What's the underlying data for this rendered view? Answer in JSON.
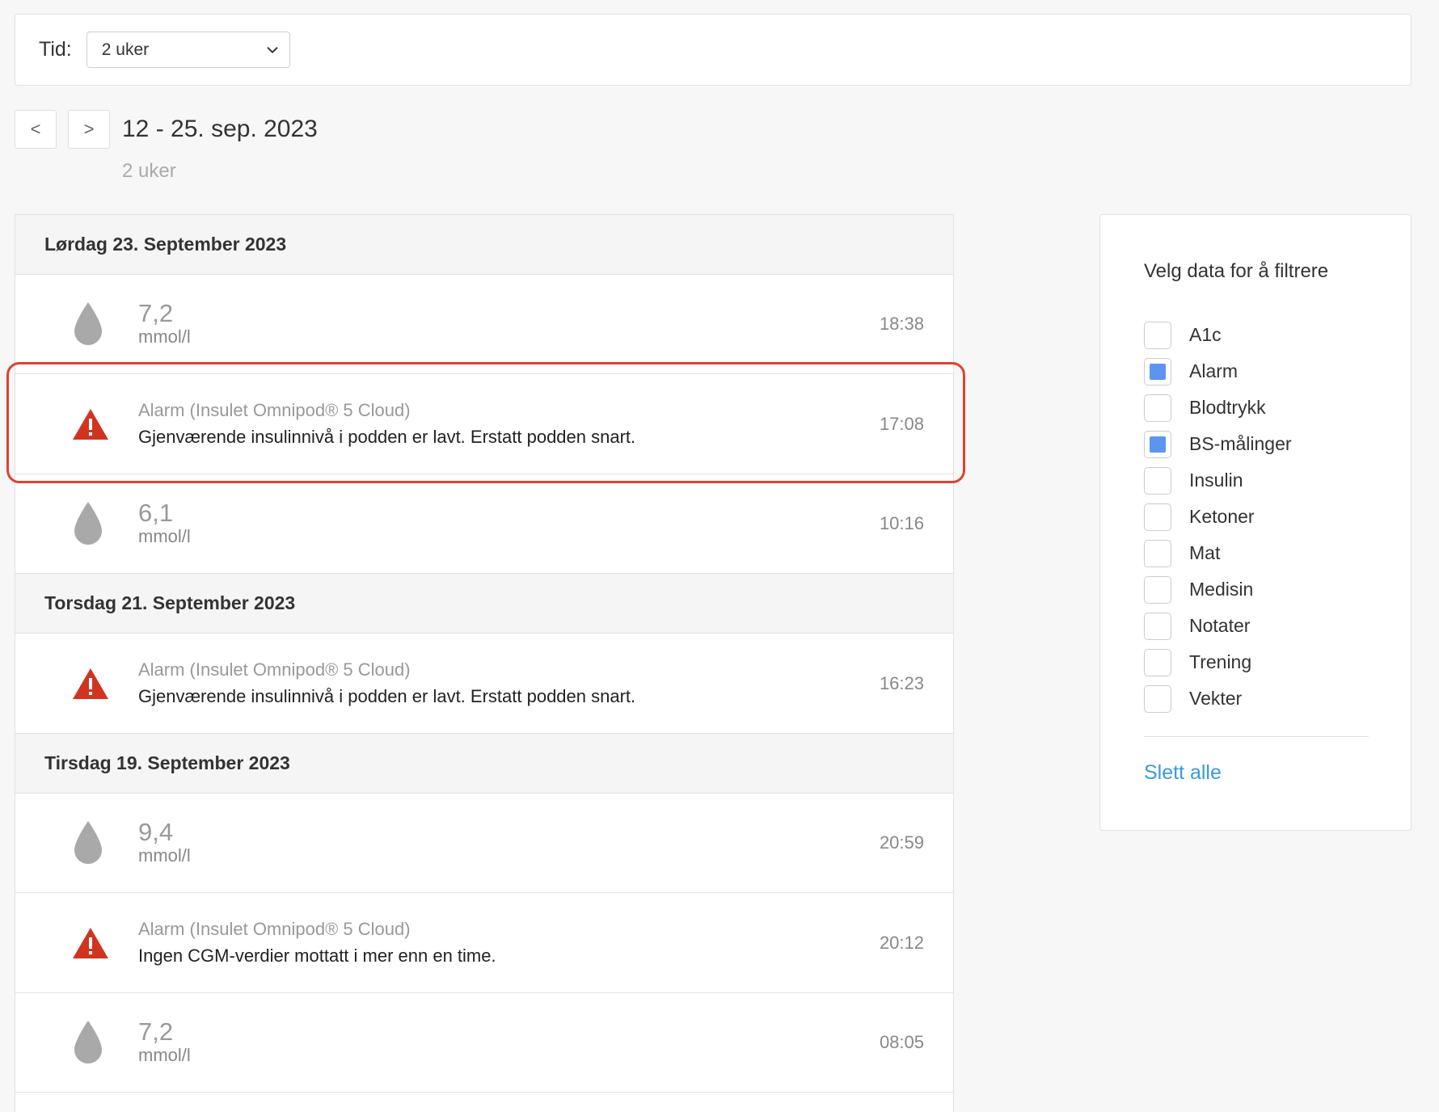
{
  "top_bar": {
    "time_label": "Tid:",
    "time_select_value": "2 uker"
  },
  "navigation": {
    "prev_label": "<",
    "next_label": ">",
    "range_title": "12 - 25. sep. 2023",
    "range_subtitle": "2 uker"
  },
  "days": [
    {
      "header": "Lørdag 23. September 2023",
      "entries": [
        {
          "type": "bs",
          "value": "7,2",
          "unit": "mmol/l",
          "time": "18:38"
        },
        {
          "type": "alarm",
          "source": "Alarm (Insulet Omnipod® 5 Cloud)",
          "message": "Gjenværende insulinnivå i podden er lavt. Erstatt podden snart.",
          "time": "17:08",
          "highlighted": true
        },
        {
          "type": "bs",
          "value": "6,1",
          "unit": "mmol/l",
          "time": "10:16"
        }
      ]
    },
    {
      "header": "Torsdag 21. September 2023",
      "entries": [
        {
          "type": "alarm",
          "source": "Alarm (Insulet Omnipod® 5 Cloud)",
          "message": "Gjenværende insulinnivå i podden er lavt. Erstatt podden snart.",
          "time": "16:23"
        }
      ]
    },
    {
      "header": "Tirsdag 19. September 2023",
      "entries": [
        {
          "type": "bs",
          "value": "9,4",
          "unit": "mmol/l",
          "time": "20:59"
        },
        {
          "type": "alarm",
          "source": "Alarm (Insulet Omnipod® 5 Cloud)",
          "message": "Ingen CGM-verdier mottatt i mer enn en time.",
          "time": "20:12"
        },
        {
          "type": "bs",
          "value": "7,2",
          "unit": "mmol/l",
          "time": "08:05"
        }
      ]
    }
  ],
  "filter": {
    "heading": "Velg data for å filtrere",
    "items": [
      {
        "label": "A1c",
        "checked": false
      },
      {
        "label": "Alarm",
        "checked": true
      },
      {
        "label": "Blodtrykk",
        "checked": false
      },
      {
        "label": "BS-målinger",
        "checked": true
      },
      {
        "label": "Insulin",
        "checked": false
      },
      {
        "label": "Ketoner",
        "checked": false
      },
      {
        "label": "Mat",
        "checked": false
      },
      {
        "label": "Medisin",
        "checked": false
      },
      {
        "label": "Notater",
        "checked": false
      },
      {
        "label": "Trening",
        "checked": false
      },
      {
        "label": "Vekter",
        "checked": false
      }
    ],
    "clear_all_label": "Slett alle"
  },
  "colors": {
    "accent_checkbox": "#5b95ee",
    "alarm_red": "#d0341f",
    "drop_gray": "#a9a9a9",
    "link_blue": "#3a9ad9",
    "highlight_border": "#e0412e"
  },
  "icons": {
    "blood_sugar": "water-drop-icon",
    "alarm": "warning-triangle-icon",
    "select": "chevron-down-icon"
  }
}
